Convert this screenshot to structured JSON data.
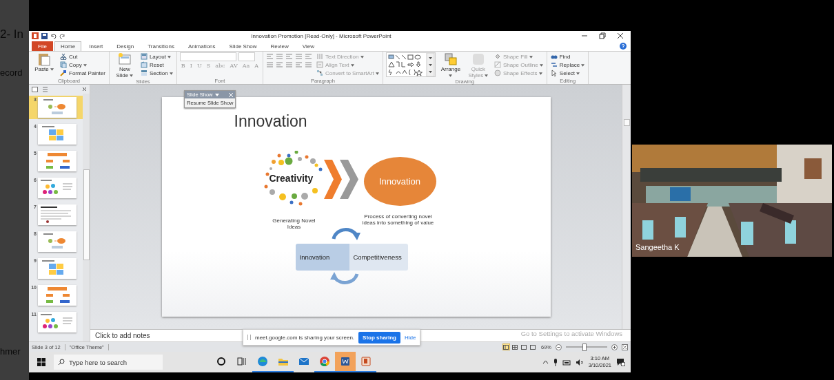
{
  "background_window": {
    "texts": [
      "2- In",
      "ecord",
      "hmer"
    ]
  },
  "window": {
    "title": "Innovation Promotion [Read-Only] - Microsoft PowerPoint"
  },
  "tabs": [
    {
      "label": "File",
      "kind": "file",
      "selected": false
    },
    {
      "label": "Home",
      "kind": "tab",
      "selected": true
    },
    {
      "label": "Insert",
      "kind": "tab",
      "selected": false
    },
    {
      "label": "Design",
      "kind": "tab",
      "selected": false
    },
    {
      "label": "Transitions",
      "kind": "tab",
      "selected": false
    },
    {
      "label": "Animations",
      "kind": "tab",
      "selected": false
    },
    {
      "label": "Slide Show",
      "kind": "tab",
      "selected": false
    },
    {
      "label": "Review",
      "kind": "tab",
      "selected": false
    },
    {
      "label": "View",
      "kind": "tab",
      "selected": false
    }
  ],
  "ribbon": [
    {
      "kind": "clipboard",
      "label": "Clipboard",
      "buttons": [
        {
          "label": "Paste",
          "kind": "large",
          "dropdown": true,
          "disabled": false
        },
        {
          "label": "Cut",
          "kind": "small",
          "dropdown": false,
          "disabled": false
        },
        {
          "label": "Copy",
          "kind": "small",
          "dropdown": true,
          "disabled": false
        },
        {
          "label": "Format Painter",
          "kind": "small",
          "dropdown": false,
          "disabled": false
        }
      ]
    },
    {
      "kind": "slides",
      "label": "Slides",
      "buttons": [
        {
          "label": "New Slide",
          "kind": "large",
          "dropdown": true,
          "disabled": false
        },
        {
          "label": "Layout",
          "kind": "small",
          "dropdown": true,
          "disabled": false
        },
        {
          "label": "Reset",
          "kind": "small",
          "dropdown": false,
          "disabled": false
        },
        {
          "label": "Section",
          "kind": "small",
          "dropdown": true,
          "disabled": false
        }
      ]
    },
    {
      "kind": "font",
      "label": "Font",
      "format_buttons": [
        "B",
        "I",
        "U",
        "S",
        "abc",
        "AV",
        "Aa",
        "A"
      ]
    },
    {
      "kind": "paragraph",
      "label": "Paragraph",
      "buttons": [
        {
          "label": "Text Direction",
          "kind": "small",
          "dropdown": true,
          "disabled": true
        },
        {
          "label": "Align Text",
          "kind": "small",
          "dropdown": true,
          "disabled": true
        },
        {
          "label": "Convert to SmartArt",
          "kind": "small",
          "dropdown": true,
          "disabled": true
        }
      ]
    },
    {
      "kind": "drawing",
      "label": "Drawing",
      "buttons": [
        {
          "label": "Arrange",
          "kind": "large",
          "dropdown": true,
          "disabled": false
        },
        {
          "label": "Quick Styles",
          "kind": "large",
          "dropdown": true,
          "disabled": true
        },
        {
          "label": "Shape Fill",
          "kind": "small",
          "dropdown": true,
          "disabled": true
        },
        {
          "label": "Shape Outline",
          "kind": "small",
          "dropdown": true,
          "disabled": true
        },
        {
          "label": "Shape Effects",
          "kind": "small",
          "dropdown": true,
          "disabled": true
        }
      ]
    },
    {
      "kind": "editing",
      "label": "Editing",
      "buttons": [
        {
          "label": "Find",
          "kind": "small",
          "dropdown": false,
          "disabled": false
        },
        {
          "label": "Replace",
          "kind": "small",
          "dropdown": true,
          "disabled": false
        },
        {
          "label": "Select",
          "kind": "small",
          "dropdown": true,
          "disabled": false
        }
      ]
    }
  ],
  "slide_show_toolbar": {
    "title": "Slide Show",
    "command": "Resume Slide Show"
  },
  "thumbnails": [
    {
      "number": "3",
      "selected": true
    },
    {
      "number": "4",
      "selected": false
    },
    {
      "number": "5",
      "selected": false
    },
    {
      "number": "6",
      "selected": false
    },
    {
      "number": "7",
      "selected": false
    },
    {
      "number": "8",
      "selected": false
    },
    {
      "number": "9",
      "selected": false
    },
    {
      "number": "10",
      "selected": false
    },
    {
      "number": "11",
      "selected": false
    }
  ],
  "slide": {
    "title": "Innovation",
    "source": {
      "label": "Creativity",
      "caption": "Generating Novel Ideas"
    },
    "target": {
      "label": "Innovation",
      "caption": "Process of converting novel ideas into something of value"
    },
    "cycle": [
      "Innovation",
      "Competitiveness"
    ]
  },
  "notes": {
    "prompt": "Click to add notes"
  },
  "activation": {
    "text": "Go to Settings to activate Windows"
  },
  "share_bar": {
    "message": "meet.google.com is sharing your screen.",
    "stop": "Stop sharing",
    "hide": "Hide"
  },
  "status_bar": {
    "slide": "Slide 3 of 12",
    "theme": "\"Office Theme\"",
    "views": [
      {
        "selected": true
      },
      {
        "selected": false
      },
      {
        "selected": false
      },
      {
        "selected": false
      }
    ],
    "zoom": "69%",
    "zoom_slider": {
      "level": 0.45
    }
  },
  "taskbar": {
    "search": {
      "placeholder": "Type here to search"
    },
    "apps": [
      {
        "running": false,
        "selected": false
      },
      {
        "running": false,
        "selected": false
      },
      {
        "running": true,
        "selected": false
      },
      {
        "running": true,
        "selected": false
      },
      {
        "running": false,
        "selected": false
      },
      {
        "running": true,
        "selected": false
      },
      {
        "running": true,
        "selected": true
      },
      {
        "running": true,
        "selected": false
      }
    ],
    "time": "3:10 AM",
    "date": "3/10/2021"
  },
  "video": {
    "name": "Sangeetha K",
    "kind": "picture"
  }
}
